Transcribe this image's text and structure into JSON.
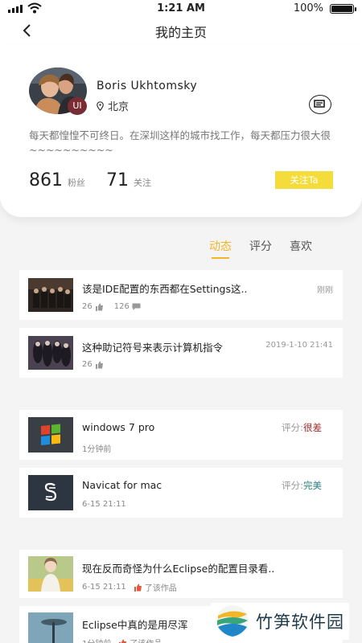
{
  "status_bar": {
    "time": "1:21 AM",
    "battery": "100%"
  },
  "header": {
    "title": "我的主页"
  },
  "profile": {
    "name": "Boris Ukhtomsky",
    "badge": "UI",
    "location": "北京",
    "bio": "每天都惶惶不可终日。在深圳这样的城市找工作，每天都压力很大很~~~~~~~~~~",
    "fans_count": "861",
    "fans_label": "粉丝",
    "following_count": "71",
    "following_label": "关注",
    "follow_button": "关注Ta"
  },
  "tabs": [
    {
      "label": "动态",
      "active": true
    },
    {
      "label": "评分",
      "active": false
    },
    {
      "label": "喜欢",
      "active": false
    }
  ],
  "posts": [
    {
      "title": "该是IDE配置的东西都在Settings这..",
      "time": "刚刚",
      "likes": "26",
      "comments": "126"
    },
    {
      "title": "这种助记符号来表示计算机指令",
      "time": "2019-1-10 21:41",
      "likes": "26"
    }
  ],
  "ratings": [
    {
      "title": "windows 7 pro",
      "rating_label": "评分:",
      "rating_value": "很差",
      "time": "1分钟前"
    },
    {
      "title": "Navicat for mac",
      "rating_label": "评分:",
      "rating_value": "完美",
      "time": "6-15 21:11"
    }
  ],
  "likes": [
    {
      "title": "现在反而奇怪为什么Eclipse的配置目录看..",
      "time": "6-15 21:11",
      "action": "了该作品"
    },
    {
      "title": "Eclipse中真的是用尽浑",
      "time": "1分钟前",
      "action": "了该作品"
    }
  ],
  "watermark": {
    "text": "竹笋软件园"
  },
  "colors": {
    "accent": "#f2b628",
    "follow_button": "#f4dc3a",
    "bad": "#9b2a2a",
    "good": "#2c7f7e",
    "badge": "#7a2c32"
  }
}
